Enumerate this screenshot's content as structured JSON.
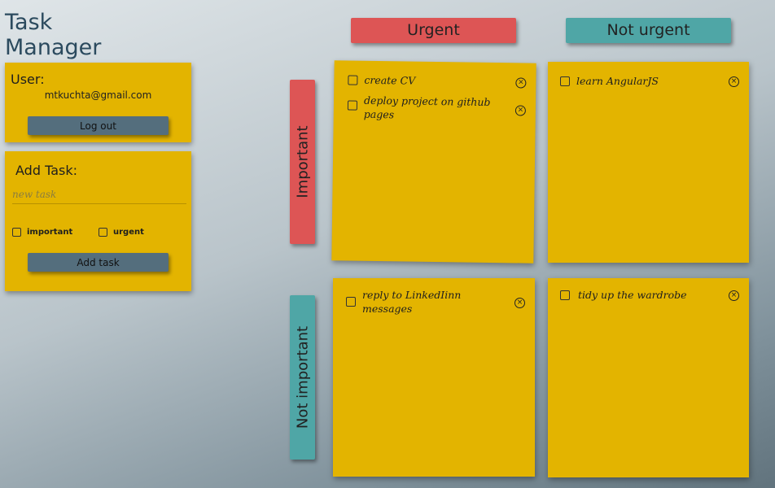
{
  "app": {
    "title": "Task Manager"
  },
  "user_panel": {
    "label": "User:",
    "email": "mtkuchta@gmail.com",
    "logout_label": "Log out"
  },
  "add_panel": {
    "label": "Add Task:",
    "placeholder": "new task",
    "important_label": "important",
    "urgent_label": "urgent",
    "add_label": "Add task"
  },
  "matrix": {
    "col_urgent": "Urgent",
    "col_not_urgent": "Not urgent",
    "row_important": "Important",
    "row_not_important": "Not important",
    "important_urgent": [
      {
        "text": "create CV"
      },
      {
        "text": "deploy project on github pages"
      }
    ],
    "important_not_urgent": [
      {
        "text": "learn AngularJS"
      }
    ],
    "not_important_urgent": [
      {
        "text": "reply to LinkedIinn messages"
      }
    ],
    "not_important_not_urgent": [
      {
        "text": "tidy up the wardrobe"
      }
    ]
  },
  "colors": {
    "note": "#e3b400",
    "urgent": "#dd5555",
    "not_urgent": "#4fa6a6",
    "button": "#546e7d"
  },
  "icons": {
    "delete": "circle-x-icon"
  }
}
